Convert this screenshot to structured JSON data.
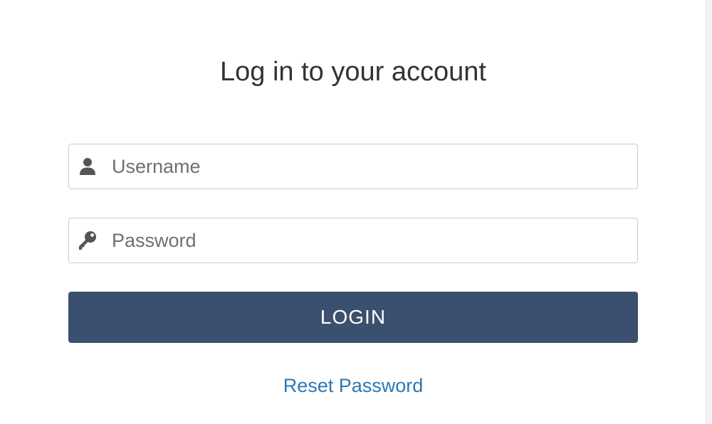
{
  "title": "Log in to your account",
  "username": {
    "placeholder": "Username",
    "value": "",
    "icon": "user-icon"
  },
  "password": {
    "placeholder": "Password",
    "value": "",
    "icon": "key-icon"
  },
  "login_label": "LOGIN",
  "reset_label": "Reset Password",
  "colors": {
    "button": "#3b506e",
    "link": "#2a78b8",
    "icon": "#555555",
    "border": "#cccccc"
  }
}
